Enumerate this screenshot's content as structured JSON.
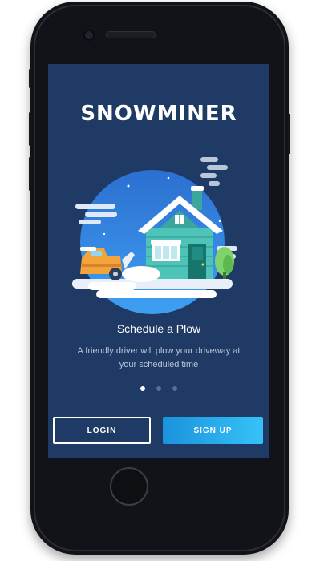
{
  "app": {
    "logo_text": "SNOWMINER"
  },
  "slide": {
    "title": "Schedule a Plow",
    "description": "A friendly driver will plow your driveway at your scheduled time",
    "illustration": "house-with-snowplow-illustration"
  },
  "pager": {
    "count": 3,
    "active_index": 0
  },
  "actions": {
    "login_label": "LOGIN",
    "signup_label": "SIGN UP"
  },
  "colors": {
    "screen_background": "#1f3a64",
    "signup_gradient_start": "#1a93dd",
    "signup_gradient_end": "#36c2f8",
    "house": "#4ec3b8",
    "plow_truck": "#f2a33a"
  }
}
